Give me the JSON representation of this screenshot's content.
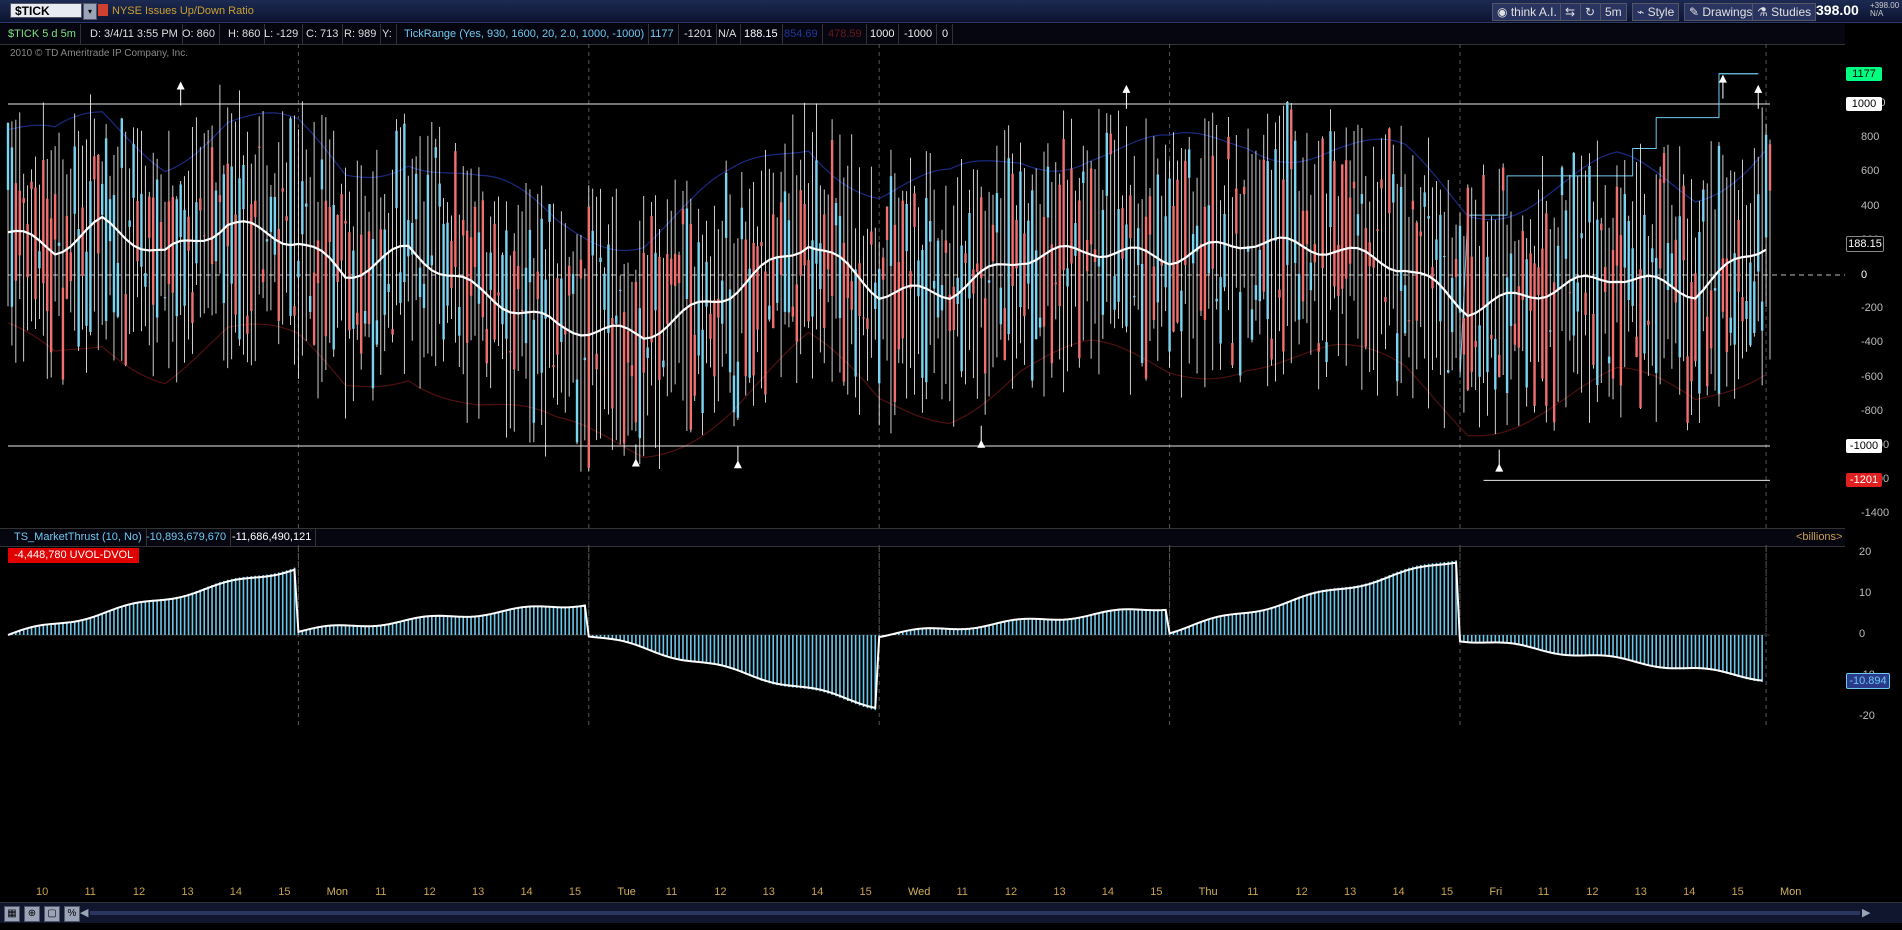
{
  "toolbar": {
    "symbol": "$TICK",
    "company": "NYSE Issues Up/Down Ratio",
    "think_label": "think A.I.",
    "timeframe": "5m",
    "style_label": "Style",
    "drawings_label": "Drawings",
    "studies_label": "Studies",
    "last_price": "398.00",
    "change_line1": "+398.00",
    "change_line2": "N/A"
  },
  "infobar": {
    "aggregation": "$TICK 5 d 5m",
    "date": "D: 3/4/11 3:55 PM",
    "open": "O: 860",
    "high": "H: 860",
    "low": "L: -129",
    "close": "C: 713",
    "range": "R: 989",
    "y": "Y:",
    "study": "TickRange (Yes, 930, 1600, 20, 2.0, 1000, -1000)",
    "v1": "1177",
    "v2": "-1201",
    "v3": "N/A",
    "v4": "188.15",
    "v5": "854.69",
    "v6": "478.59",
    "v7": "1000",
    "v8": "-1000",
    "v9": "0"
  },
  "copyright": "2010 © TD Ameritrade IP Company, Inc.",
  "lower": {
    "study": "TS_MarketThrust (10, No)",
    "v1": "-10,893,679,670",
    "v2": "-11,686,490,121",
    "units": "<billions>",
    "uvol_label": "-4,448,780 UVOL-DVOL"
  },
  "colors": {
    "up_bar": "#7ad4f0",
    "down_bar": "#f07070",
    "wick": "#ffffff",
    "ma": "#ffffff",
    "upper_band": "#1a2a80",
    "lower_band": "#501010",
    "level_line": "#e8e8e8",
    "thrust_bar": "#6ac6e8",
    "accent_tag_green": "#00ff80",
    "tag_red": "#e02020",
    "tag_white": "#ffffff"
  },
  "chart_data": [
    {
      "type": "bar",
      "title": "$TICK 5 d 5m",
      "ylim": [
        -1400,
        1200
      ],
      "y_ticks": [
        "1000",
        "800",
        "600",
        "400",
        "200",
        "0",
        "-200",
        "-400",
        "-600",
        "-800",
        "-1000",
        "-1200",
        "-1400"
      ],
      "levels": {
        "high_mark": 1177,
        "upper": 1000,
        "last": 188.15,
        "zero": 0,
        "lower": -1000,
        "low_mark": -1201
      },
      "ma_series": [
        {
          "x": 0,
          "y": 250
        },
        {
          "x": 12,
          "y": 150
        },
        {
          "x": 24,
          "y": 300
        },
        {
          "x": 40,
          "y": 120
        },
        {
          "x": 56,
          "y": 300
        },
        {
          "x": 74,
          "y": 200
        },
        {
          "x": 86,
          "y": 0
        },
        {
          "x": 102,
          "y": 150
        },
        {
          "x": 120,
          "y": -100
        },
        {
          "x": 140,
          "y": -300
        },
        {
          "x": 162,
          "y": -350
        },
        {
          "x": 184,
          "y": -100
        },
        {
          "x": 204,
          "y": 200
        },
        {
          "x": 222,
          "y": -100
        },
        {
          "x": 240,
          "y": -100
        },
        {
          "x": 258,
          "y": 100
        },
        {
          "x": 276,
          "y": 150
        },
        {
          "x": 296,
          "y": 100
        },
        {
          "x": 316,
          "y": 200
        },
        {
          "x": 338,
          "y": 150
        },
        {
          "x": 356,
          "y": 50
        },
        {
          "x": 372,
          "y": -200
        },
        {
          "x": 390,
          "y": -100
        },
        {
          "x": 410,
          "y": 0
        },
        {
          "x": 430,
          "y": -100
        },
        {
          "x": 448,
          "y": 188
        }
      ],
      "arrows_up": [
        {
          "x": 44,
          "y": 1120
        },
        {
          "x": 285,
          "y": 1100
        },
        {
          "x": 437,
          "y": 1160
        },
        {
          "x": 446,
          "y": 1100
        }
      ],
      "arrows_down": [
        {
          "x": 160,
          "y": -1120
        },
        {
          "x": 186,
          "y": -1130
        },
        {
          "x": 248,
          "y": -1010
        },
        {
          "x": 380,
          "y": -1150
        }
      ]
    },
    {
      "type": "bar",
      "title": "TS_MarketThrust (10, No)",
      "ylabel": "<billions>",
      "ylim": [
        -20,
        20
      ],
      "y_ticks": [
        "20",
        "10",
        "0",
        "-10",
        "-20"
      ],
      "last": -10.894,
      "days": [
        {
          "start": 0,
          "end": 74,
          "from": 0,
          "to": 17
        },
        {
          "start": 74,
          "end": 148,
          "from": 1,
          "to": 8
        },
        {
          "start": 148,
          "end": 222,
          "from": 0,
          "to": -18
        },
        {
          "start": 222,
          "end": 296,
          "from": 0,
          "to": 7
        },
        {
          "start": 296,
          "end": 370,
          "from": 1,
          "to": 19
        },
        {
          "start": 370,
          "end": 448,
          "from": -1,
          "to": -11
        }
      ]
    }
  ],
  "x_axis": {
    "labels": [
      "10",
      "11",
      "12",
      "13",
      "14",
      "15",
      "Mon",
      "11",
      "12",
      "13",
      "14",
      "15",
      "Tue",
      "11",
      "12",
      "13",
      "14",
      "15",
      "Wed",
      "11",
      "12",
      "13",
      "14",
      "15",
      "Thu",
      "11",
      "12",
      "13",
      "14",
      "15",
      "Fri",
      "11",
      "12",
      "13",
      "14",
      "15",
      "Mon"
    ]
  },
  "tags": {
    "t1177": "1177",
    "t1000": "1000",
    "t188": "188.15",
    "t0": "0",
    "tm1000": "-1000",
    "tm1201": "-1201",
    "tthrust": "-10.894"
  }
}
